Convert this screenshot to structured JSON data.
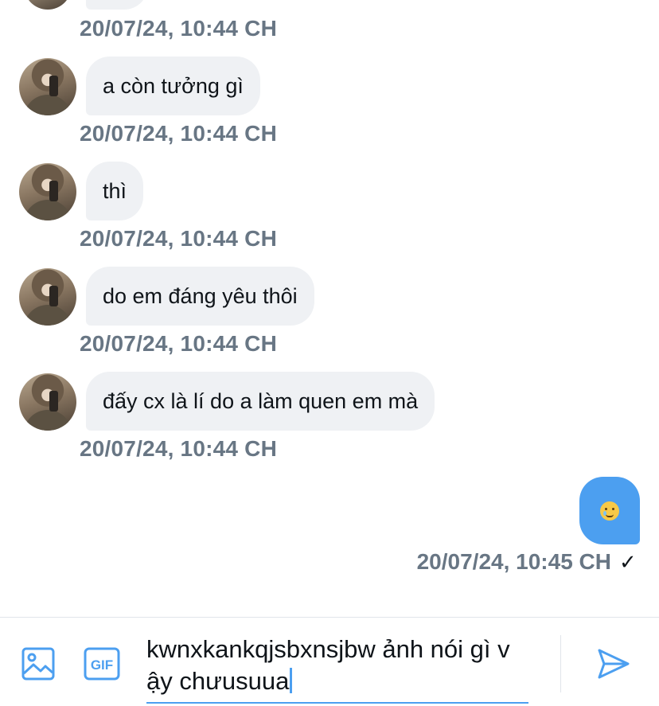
{
  "messages_in": [
    {
      "text": "a còn tưởng gì",
      "timestamp": "20/07/24, 10:44 CH"
    },
    {
      "text": "thì",
      "timestamp": "20/07/24, 10:44 CH"
    },
    {
      "text": "do em đáng yêu thôi",
      "timestamp": "20/07/24, 10:44 CH"
    },
    {
      "text": "đấy cx là lí do a làm quen em mà",
      "timestamp": "20/07/24, 10:44 CH"
    }
  ],
  "top_partial_timestamp": "20/07/24, 10:44 CH",
  "message_out": {
    "emoji": "face-holding-back-tears",
    "timestamp": "20/07/24, 10:45 CH",
    "status": "✓"
  },
  "composer": {
    "input_value": "kwnxkankqjsbxnsjbw ảnh nói gì vậy chưusuua",
    "image_icon": "image-icon",
    "gif_icon": "gif-icon",
    "gif_label": "GIF",
    "send_icon": "send-icon"
  },
  "colors": {
    "accent": "#4c9ff0",
    "bubble_in": "#eff1f4",
    "timestamp": "#687684"
  }
}
